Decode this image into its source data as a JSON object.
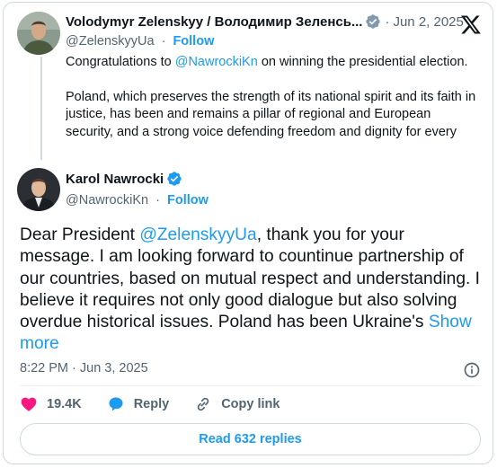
{
  "quoted": {
    "author_name": "Volodymyr Zelenskyy / Володимир Зеленсь...",
    "handle": "@ZelenskyyUa",
    "follow_label": "Follow",
    "date": "Jun 2, 2025",
    "line1_prefix": "Congratulations to ",
    "line1_mention": "@NawrockiKn",
    "line1_suffix": " on winning the presidential election.",
    "paragraph2": "Poland, which preserves the strength of its national spirit and its faith in justice, has been and remains a pillar of regional and European security, and a strong voice defending freedom and dignity for every"
  },
  "reply": {
    "author_name": "Karol Nawrocki",
    "handle": "@NawrockiKn",
    "follow_label": "Follow",
    "text_prefix": "Dear President ",
    "text_mention": "@ZelenskyyUa",
    "text_body": ", thank you for your message. I am looking forward to countinue partnership of our countries, based on mutual respect and understanding. I believe it requires not only good dialogue but also solving overdue historical issues. Poland has been Ukraine's ",
    "show_more": "Show more",
    "timestamp": "8:22 PM · Jun 3, 2025"
  },
  "actions": {
    "likes": "19.4K",
    "reply_label": "Reply",
    "copy_link_label": "Copy link"
  },
  "read_replies_label": "Read 632 replies",
  "colors": {
    "accent": "#1d9bf0",
    "like": "#f91880",
    "text": "#0f1419",
    "secondary": "#536471",
    "verified": "#1d9bf0"
  }
}
